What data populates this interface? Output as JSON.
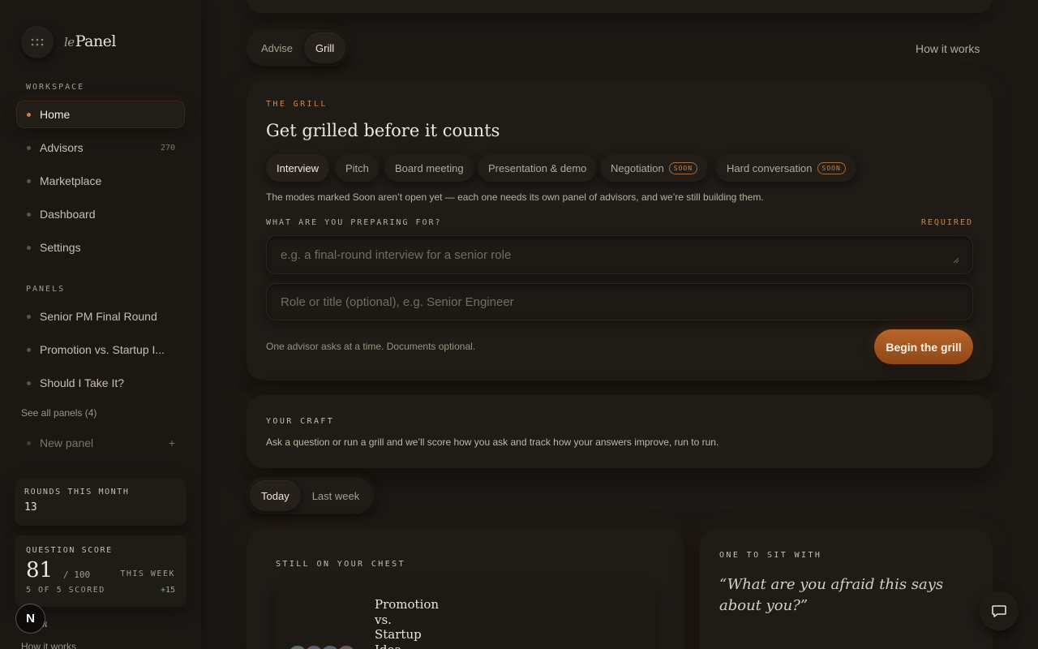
{
  "sidebar": {
    "logo": {
      "prefix": "le",
      "name": "Panel"
    },
    "workspace_label": "WORKSPACE",
    "nav": [
      {
        "label": "Home",
        "active": true
      },
      {
        "label": "Advisors",
        "count": "270"
      },
      {
        "label": "Marketplace"
      },
      {
        "label": "Dashboard"
      },
      {
        "label": "Settings"
      }
    ],
    "panels_label": "PANELS",
    "panels": [
      {
        "label": "Senior PM Final Round"
      },
      {
        "label": "Promotion vs. Startup I..."
      },
      {
        "label": "Should I Take It?"
      }
    ],
    "see_all": "See all panels (4)",
    "new_panel": "New panel",
    "new_panel_plus": "+",
    "rounds": {
      "label": "ROUNDS THIS MONTH",
      "value": "13"
    },
    "question_score": {
      "label": "QUESTION SCORE",
      "score": "81",
      "out_of": "/ 100",
      "period": "THIS WEEK",
      "scored": "5 OF 5 SCORED",
      "delta": "+15"
    },
    "avatar_letter": "N",
    "partial_label": "IN",
    "bottom_link": "How it works"
  },
  "header": {
    "modes": [
      {
        "label": "Advise",
        "active": false
      },
      {
        "label": "Grill",
        "active": true
      }
    ],
    "how_it_works": "How it works"
  },
  "grill": {
    "eyebrow": "THE GRILL",
    "title": "Get grilled before it counts",
    "modes": [
      {
        "label": "Interview",
        "active": true
      },
      {
        "label": "Pitch"
      },
      {
        "label": "Board meeting"
      },
      {
        "label": "Presentation & demo"
      },
      {
        "label": "Negotiation",
        "badge": "SOON"
      },
      {
        "label": "Hard conversation",
        "badge": "SOON"
      }
    ],
    "note": "The modes marked Soon aren’t open yet — each one needs its own panel of advisors, and we’re still building them.",
    "prep_label": "WHAT ARE YOU PREPARING FOR?",
    "required": "REQUIRED",
    "prep_placeholder": "e.g. a final-round interview for a senior role",
    "role_placeholder": "Role or title (optional), e.g. Senior Engineer",
    "footnote": "One advisor asks at a time. Documents optional.",
    "cta": "Begin the grill"
  },
  "craft": {
    "eyebrow": "YOUR CRAFT",
    "text": "Ask a question or run a grill and we’ll score how you ask and track how your answers improve, run to run."
  },
  "range_tabs": [
    {
      "label": "Today",
      "active": true
    },
    {
      "label": "Last week",
      "active": false
    }
  ],
  "chest": {
    "eyebrow": "STILL ON YOUR CHEST",
    "title_lines": [
      "Promotion",
      "vs.",
      "Startup",
      "Idea"
    ]
  },
  "sit_with": {
    "eyebrow": "ONE TO SIT WITH",
    "quote": "“What are you afraid this says about you?”"
  },
  "colors": {
    "accent": "#d47b3c",
    "cta": "#a9581f",
    "bg": "#1c1915",
    "positive": "#7fb77e"
  }
}
